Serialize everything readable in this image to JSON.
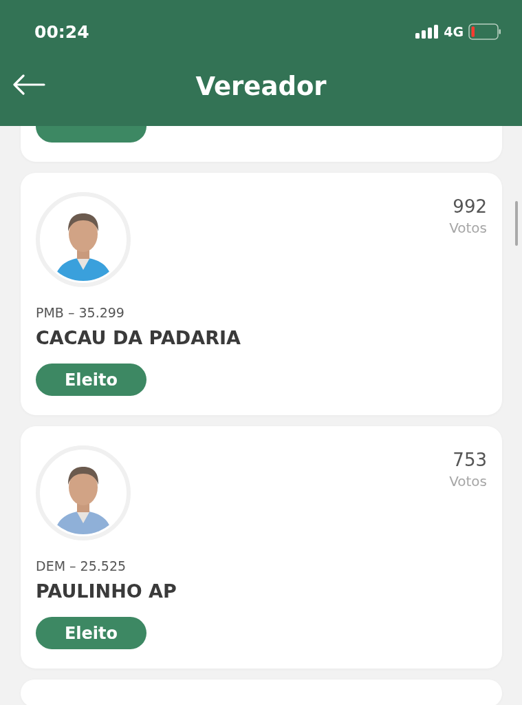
{
  "status_bar": {
    "time": "00:24",
    "network": "4G"
  },
  "header": {
    "title": "Vereador"
  },
  "candidates": [
    {
      "party_number": "PMB – 35.299",
      "name": "CACAU DA PADARIA",
      "votes": "992",
      "votes_label": "Votos",
      "status": "Eleito"
    },
    {
      "party_number": "DEM – 25.525",
      "name": "PAULINHO AP",
      "votes": "753",
      "votes_label": "Votos",
      "status": "Eleito"
    }
  ]
}
